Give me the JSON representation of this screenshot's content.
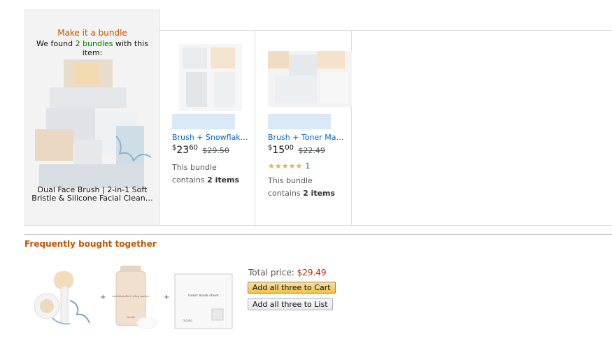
{
  "bundle_panel": {
    "title": "Make it a bundle",
    "found_prefix": "We found",
    "found_link": "2 bundles",
    "found_suffix": "with this item:",
    "item_name": "Dual Face Brush | 2-in-1 Soft Bristle & Silicone Facial Clean…"
  },
  "bundles": [
    {
      "name": "Brush + Snowflak…",
      "price_whole": "23",
      "price_frac": "60",
      "price_currency": "$",
      "old_price": "$29.50",
      "contains_prefix": "This bundle contains",
      "contains_count": "2 items"
    },
    {
      "name": "Brush + Toner Ma…",
      "price_whole": "15",
      "price_frac": "00",
      "price_currency": "$",
      "old_price": "$22.49",
      "stars": "★★★★★",
      "rating_count": "1",
      "contains_prefix": "This bundle contains",
      "contains_count": "2 items"
    }
  ],
  "fbt": {
    "title": "Frequently bought together",
    "plus": "+",
    "total_label": "Total price:",
    "total_price": "$29.49",
    "add_cart": "Add all three to Cart",
    "add_list": "Add all three to List",
    "product2_label": "marshmallow whip maker",
    "product2_brand": "tocobo",
    "product3_label": "toner mask sheet",
    "product3_brand": "tocobo"
  },
  "colors": {
    "accent_orange": "#c45500",
    "link_blue": "#0066c0",
    "price_red": "#b12704",
    "green": "#007600",
    "star": "#f3a847"
  }
}
